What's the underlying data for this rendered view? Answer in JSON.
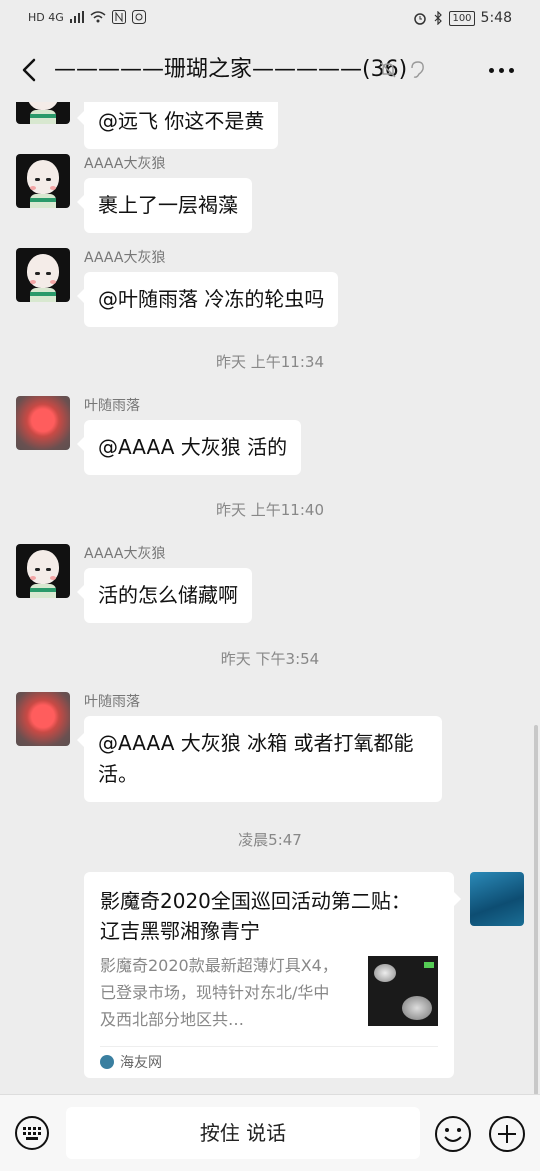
{
  "status_bar": {
    "network_left": "HD 4G",
    "battery": "100",
    "time": "5:48"
  },
  "header": {
    "title": "—————珊瑚之家—————(36)"
  },
  "messages": [
    {
      "sender": "",
      "text": "@远飞 你这不是黄"
    },
    {
      "sender": "AAAA大灰狼",
      "text": "裹上了一层褐藻"
    },
    {
      "sender": "AAAA大灰狼",
      "text": "@叶随雨落  冷冻的轮虫吗"
    },
    {
      "sender": "叶随雨落",
      "text": "@AAAA 大灰狼  活的"
    },
    {
      "sender": "AAAA大灰狼",
      "text": "活的怎么储藏啊"
    },
    {
      "sender": "叶随雨落",
      "text": "@AAAA 大灰狼  冰箱 或者打氧都能活。"
    }
  ],
  "timestamps": [
    "昨天 上午11:34",
    "昨天 上午11:40",
    "昨天 下午3:54",
    "凌晨5:47"
  ],
  "link_card": {
    "title": "影魔奇2020全国巡回活动第二贴：  辽吉黑鄂湘豫青宁",
    "description": "影魔奇2020款最新超薄灯具X4，已登录市场，现特针对东北/华中及西北部分地区共…",
    "source": "海友网"
  },
  "input_bar": {
    "hold_to_talk": "按住 说话"
  },
  "icons": [
    "back-icon",
    "mute-icon",
    "ear-icon",
    "more-icon",
    "keyboard-icon",
    "emoji-icon",
    "plus-icon"
  ]
}
